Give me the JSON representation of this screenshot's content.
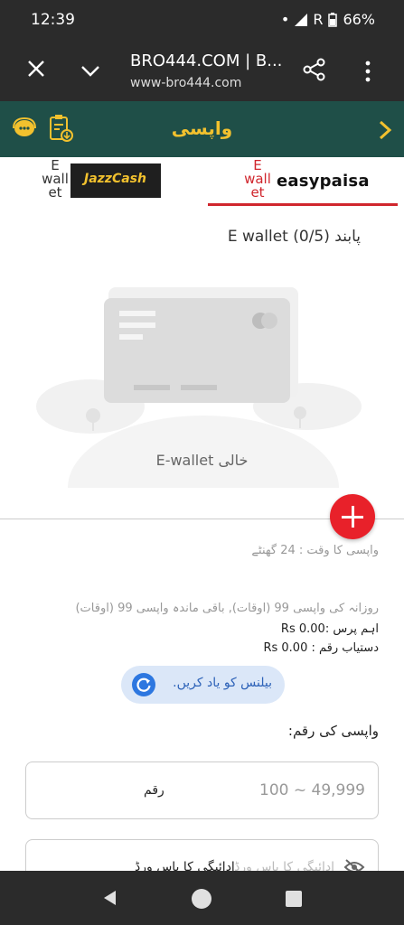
{
  "status": {
    "time": "12:39",
    "battery": "66%",
    "signal": "R"
  },
  "browser": {
    "title": "BRO444.COM | B...",
    "url": "www-bro444.com"
  },
  "header": {
    "title": "واپسی"
  },
  "tabs": [
    {
      "label": "E wall et",
      "brand": "JazzCash"
    },
    {
      "label": "E wall et",
      "brand": "easypaisa"
    }
  ],
  "wallet": {
    "count": "پابند E wallet (0/5)",
    "empty": "خالی E-wallet"
  },
  "withdraw": {
    "time": "واپسی کا وقت : 24 گھنٹے",
    "daily": "روزانہ کی واپسی 99 (اوقات), باقی ماندہ واپسی 99 (اوقات)",
    "balance": "اہم پرس :0.00 Rs",
    "available": "دستیاب رقم : 0.00 Rs",
    "refresh": "بیلنس کو یاد کریں.",
    "amount_label": "واپسی کی رقم:",
    "amount_range": "100 ~ 49,999",
    "amount_unit": "رقم",
    "pwd_placeholder": "ادائیگی کا پاس ورڈ",
    "pwd_label": "ادائیگی کا پاس ورڈ"
  },
  "colors": {
    "header": "#1f4f48",
    "accent": "#f2c12e",
    "primary": "#e8212a",
    "link": "#2d62b8"
  }
}
